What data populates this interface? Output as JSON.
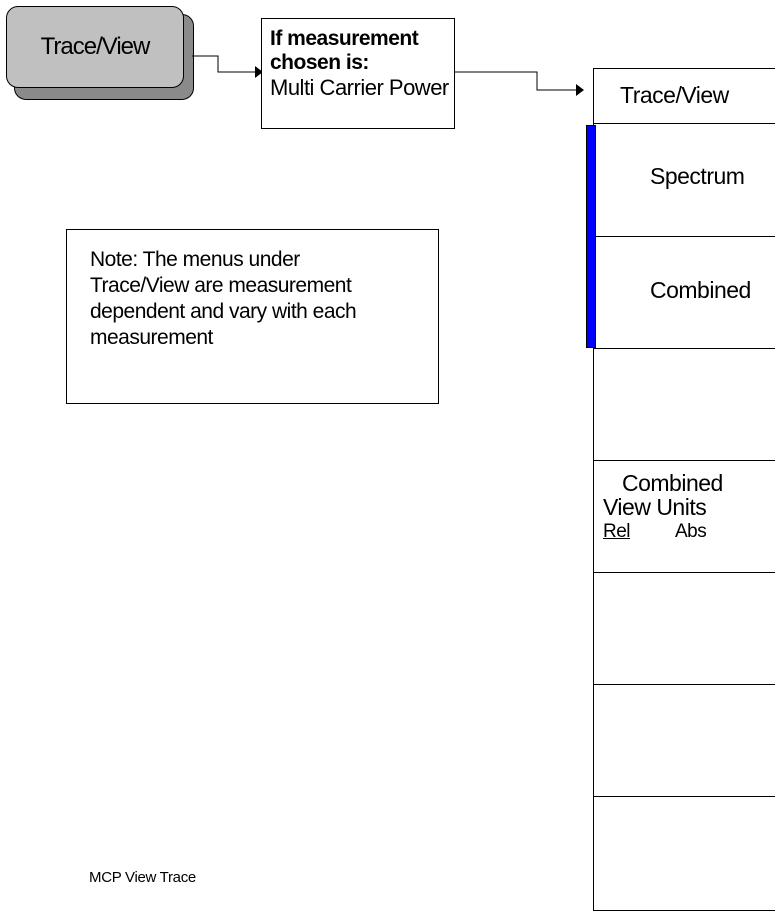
{
  "hardkey": {
    "label": "Trace/View"
  },
  "condition": {
    "line1": "If measurement",
    "line2": "chosen is:",
    "measurement": "Multi Carrier Power"
  },
  "note": {
    "lines": [
      "Note: The menus under",
      "Trace/View are measurement",
      "dependent and vary with each",
      "measurement"
    ]
  },
  "menu": {
    "title": "Trace/View",
    "keys": [
      {
        "label": "Spectrum"
      },
      {
        "label": "Combined"
      },
      {
        "label": ""
      },
      {
        "label1": "Combined",
        "label2": "View Units",
        "opt_rel": "Rel",
        "opt_abs": "Abs"
      },
      {
        "label": ""
      },
      {
        "label": ""
      },
      {
        "label": ""
      }
    ]
  },
  "caption": "MCP View Trace",
  "colors": {
    "active_bar": "#0000ff",
    "key_face": "#c0c0c0",
    "key_shadow": "#8a8a8a"
  }
}
